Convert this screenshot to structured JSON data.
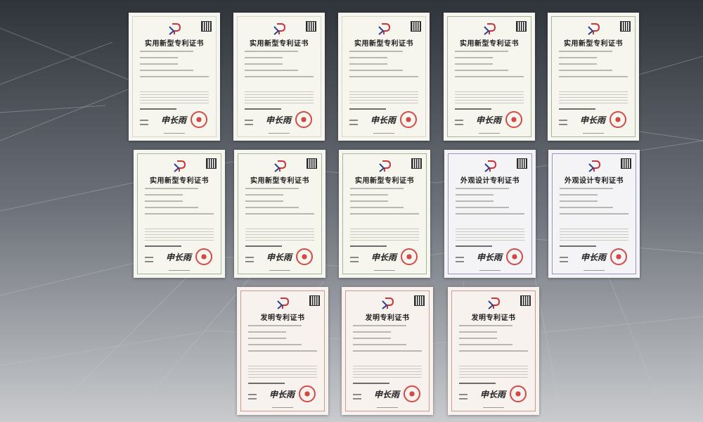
{
  "certificates": [
    {
      "title": "实用新型专利证书",
      "type": "utility"
    },
    {
      "title": "实用新型专利证书",
      "type": "utility"
    },
    {
      "title": "实用新型专利证书",
      "type": "utility"
    },
    {
      "title": "实用新型专利证书",
      "type": "utility"
    },
    {
      "title": "实用新型专利证书",
      "type": "utility"
    },
    {
      "title": "实用新型专利证书",
      "type": "utility"
    },
    {
      "title": "实用新型专利证书",
      "type": "utility"
    },
    {
      "title": "实用新型专利证书",
      "type": "utility"
    },
    {
      "title": "外观设计专利证书",
      "type": "design"
    },
    {
      "title": "外观设计专利证书",
      "type": "design"
    },
    {
      "title": "发明专利证书",
      "type": "invention"
    },
    {
      "title": "发明专利证书",
      "type": "invention"
    },
    {
      "title": "发明专利证书",
      "type": "invention"
    }
  ],
  "signature": "申长雨"
}
